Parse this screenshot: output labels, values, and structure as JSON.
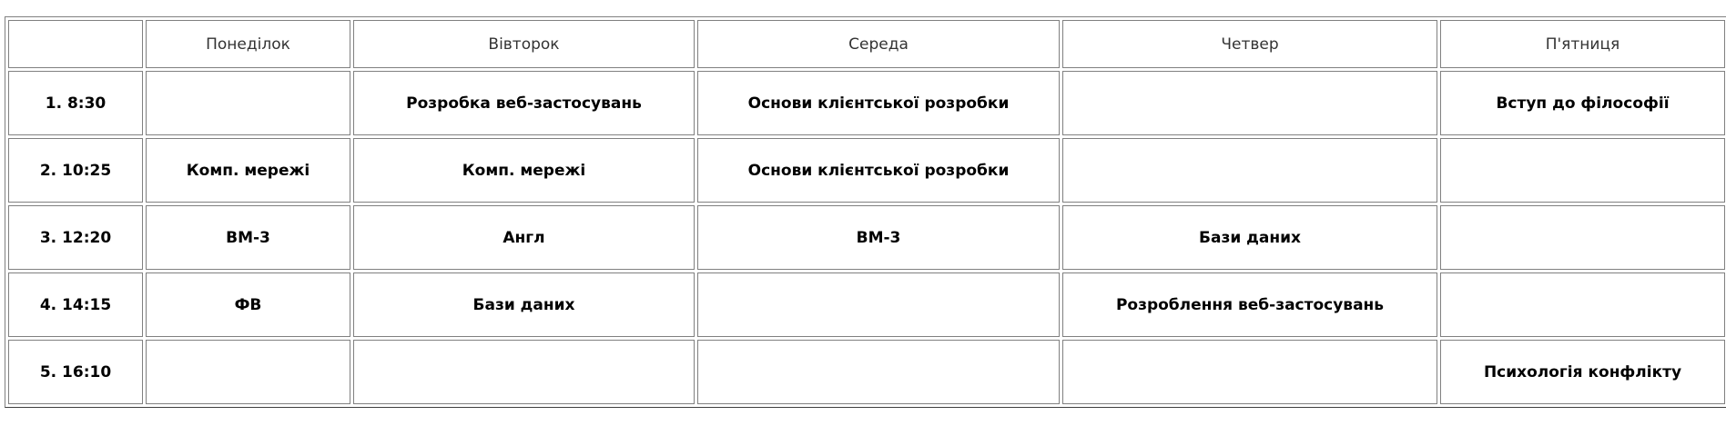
{
  "schedule": {
    "headers": [
      "",
      "Понеділок",
      "Вівторок",
      "Середа",
      "Четвер",
      "П'ятниця"
    ],
    "rows": [
      {
        "time": "1. 8:30",
        "cells": [
          "",
          "Розробка веб-застосувань",
          "Основи клієнтської розробки",
          "",
          "Вступ до філософії"
        ]
      },
      {
        "time": "2. 10:25",
        "cells": [
          "Комп. мережі",
          "Комп. мережі",
          "Основи клієнтської розробки",
          "",
          ""
        ]
      },
      {
        "time": "3. 12:20",
        "cells": [
          "ВМ-3",
          "Англ",
          "ВМ-3",
          "Бази даних",
          ""
        ]
      },
      {
        "time": "4. 14:15",
        "cells": [
          "ФВ",
          "Бази даних",
          "",
          "Розроблення веб-застосувань",
          ""
        ]
      },
      {
        "time": "5. 16:10",
        "cells": [
          "",
          "",
          "",
          "",
          "Психологія конфлікту"
        ]
      }
    ]
  }
}
